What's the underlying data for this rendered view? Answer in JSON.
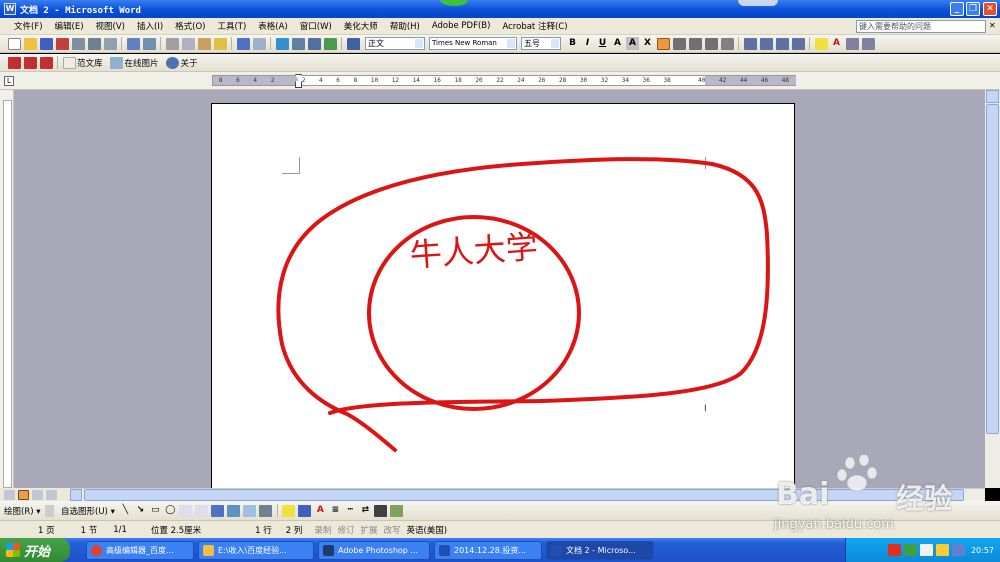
{
  "window": {
    "title": "文档 2 - Microsoft Word"
  },
  "menu": {
    "items": [
      "文件(F)",
      "编辑(E)",
      "视图(V)",
      "插入(I)",
      "格式(O)",
      "工具(T)",
      "表格(A)",
      "窗口(W)",
      "美化大师",
      "帮助(H)",
      "Adobe PDF(B)",
      "Acrobat 注释(C)"
    ],
    "help_placeholder": "键入需要帮助的问题"
  },
  "format": {
    "style": "正文",
    "font": "Times New Roman",
    "size": "五号"
  },
  "toolbar3": {
    "fanwenku": "范文库",
    "online_pic": "在线图片",
    "about": "关于"
  },
  "ruler": {
    "numbers": [
      "8",
      "6",
      "4",
      "2",
      "",
      "2",
      "4",
      "6",
      "8",
      "10",
      "12",
      "14",
      "16",
      "18",
      "20",
      "22",
      "24",
      "26",
      "28",
      "30",
      "32",
      "34",
      "36",
      "38",
      "",
      "40",
      "42",
      "44",
      "46",
      "48"
    ]
  },
  "document": {
    "stamp_text": "牛人大学",
    "stamp_color": "#dc1414"
  },
  "drawbar": {
    "draw": "绘图(R) ▾",
    "autoshape": "自选图形(U) ▾"
  },
  "status": {
    "page": "1 页",
    "section": "1 节",
    "pages": "1/1",
    "position": "位置 2.5厘米",
    "line": "1 行",
    "col": "2 列",
    "rec": "录制",
    "trk": "修订",
    "ext": "扩展",
    "ovr": "改写",
    "lang": "英语(美国)"
  },
  "taskbar": {
    "start": "开始",
    "tasks": [
      "高级编辑器_百度...",
      "E:\\收入\\百度经验...",
      "Adobe Photoshop ...",
      "2014.12.28.投资...",
      "文档 2 - Microso..."
    ],
    "clock": "20:57"
  },
  "watermark": {
    "brand": "Bai",
    "brand2": "经验",
    "url": "jingyan.baidu.com"
  }
}
